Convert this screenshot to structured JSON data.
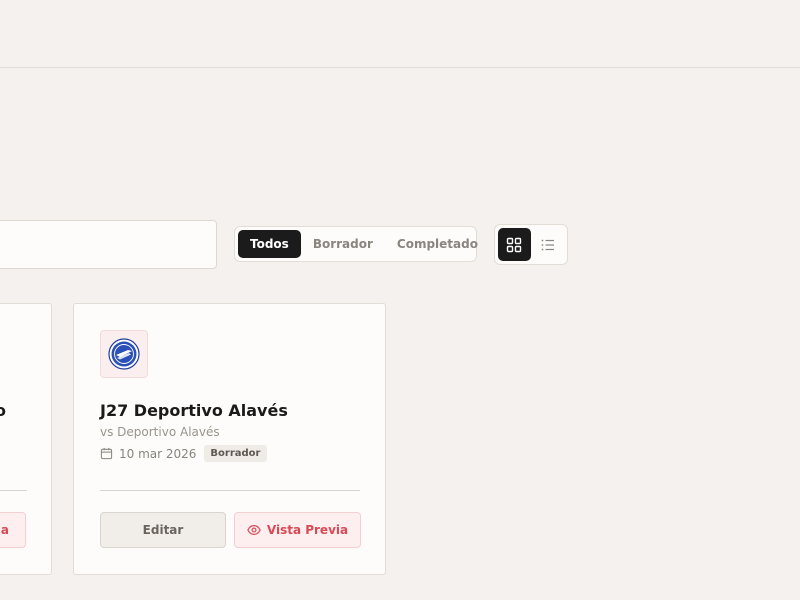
{
  "filters": {
    "todos": "Todos",
    "borrador": "Borrador",
    "completado": "Completado",
    "active": "Todos"
  },
  "view_toggle": {
    "grid_icon": "grid-icon",
    "list_icon": "list-icon",
    "active": "grid"
  },
  "cards": [
    {
      "title_fragment": "o",
      "preview_fragment": "a"
    },
    {
      "title": "J27 Deportivo Alavés",
      "subtitle": "vs Deportivo Alavés",
      "date": "10 mar 2026",
      "status": "Borrador",
      "edit_label": "Editar",
      "preview_label": "Vista Previa",
      "logo_icon": "team-crest-icon"
    }
  ],
  "colors": {
    "accent": "#d84a55",
    "active_dark": "#1b1b1b",
    "background": "#f4f1ee"
  }
}
